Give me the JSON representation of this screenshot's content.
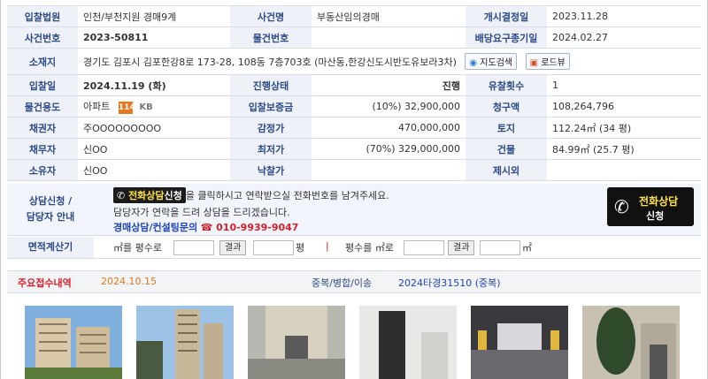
{
  "row1": {
    "court_label": "입찰법원",
    "court": "인천/부천지원 경매9계",
    "case_type_label": "사건명",
    "case_type": "부동산임의경매",
    "start_label": "개시결정일",
    "start_date": "2023.11.28"
  },
  "row2": {
    "case_no_label": "사건번호",
    "case_no": "2023-50811",
    "item_no_label": "물건번호",
    "item_no": "",
    "dividend_label": "배당요구종기일",
    "dividend_date": "2024.02.27"
  },
  "row3": {
    "address_label": "소재지",
    "address": "경기도 김포시 김포한강8로 173-28, 108동 7층703호 (마산동,한강신도시반도유보라3차)",
    "map_button": "지도검색",
    "road_button": "로드뷰"
  },
  "row4": {
    "bid_date_label": "입찰일",
    "bid_date": "2024.11.19 (화)",
    "status_label": "진행상태",
    "status": "진행",
    "fail_label": "유찰횟수",
    "fail_count": "1"
  },
  "row5": {
    "usage_label": "물건용도",
    "usage": "아파트",
    "badge_114": "114",
    "badge_kb": "KB",
    "deposit_label": "입찰보증금",
    "deposit": "(10%) 32,900,000",
    "claim_label": "청구액",
    "claim": "108,264,796"
  },
  "row6": {
    "creditor_label": "채권자",
    "creditor": "주OOOOOOOOO",
    "appraisal_label": "감정가",
    "appraisal": "470,000,000",
    "land_label": "토지",
    "land": "112.24㎡ (34 평)"
  },
  "row7": {
    "debtor_label": "채무자",
    "debtor": "신OO",
    "min_label": "최저가",
    "min_price": "(70%)  329,000,000",
    "bldg_label": "건물",
    "bldg": "84.99㎡ (25.7 평)"
  },
  "row8": {
    "owner_label": "소유자",
    "owner": "신OO",
    "winning_label": "낙찰가",
    "winning": "",
    "exclusion_label": "제시외",
    "exclusion": ""
  },
  "consult": {
    "label_line1": "상담신청 /",
    "label_line2": "담당자 안내",
    "chip": "전화상담",
    "chip_suffix": "신청",
    "line1": "을 클릭하시고 연락받으실 전화번호를 남겨주세요.",
    "line2": "담당자가 연락을 드려 상담을 드리겠습니다.",
    "line3_label": "경매상담/컨설팅문의",
    "phone": "☎ 010-9939-9047",
    "button_line1": "전화상담",
    "button_line2": "신청"
  },
  "calc": {
    "label": "면적계산기",
    "sqm_to_py": "㎡를 평수로",
    "result": "결과",
    "py": "평",
    "sep": "|",
    "py_to_sqm": "평수를 ㎡로",
    "result2": "결과",
    "sqm": "㎡"
  },
  "history": {
    "label": "주요접수내역",
    "date": "2024.10.15",
    "dup_label": "중복/병합/이송",
    "dup_value": "2024타경31510 (중복)"
  },
  "photos": [
    "apartment-exterior-1",
    "apartment-exterior-2",
    "apartment-entrance",
    "hallway-door",
    "parking-garage",
    "apartment-entrance-2"
  ],
  "colors": {
    "label_bg": "#eef2f8",
    "label_text": "#2d4a86",
    "accent_blue": "#1f44b8",
    "phone_red": "#d6202a"
  }
}
